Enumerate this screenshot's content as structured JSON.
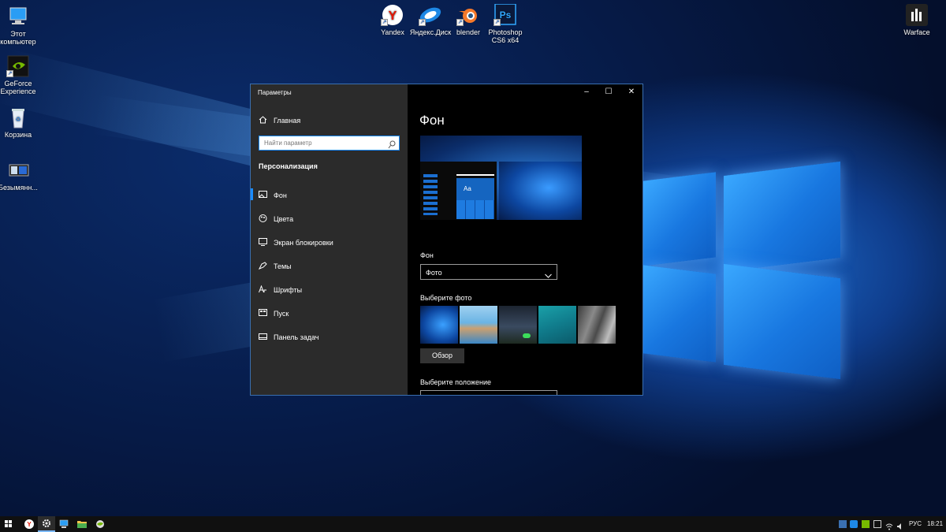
{
  "desktop_icons": [
    {
      "label": "Этот компьютер",
      "icon": "computer-icon"
    },
    {
      "label": "GeForce Experience",
      "icon": "geforce-icon"
    },
    {
      "label": "Корзина",
      "icon": "recycle-bin-icon"
    },
    {
      "label": "Безымянн...",
      "icon": "image-file-icon"
    },
    {
      "label": "Yandex",
      "icon": "yandex-icon"
    },
    {
      "label": "Яндекс.Диск",
      "icon": "yandex-disk-icon"
    },
    {
      "label": "blender",
      "icon": "blender-icon"
    },
    {
      "label": "Photoshop CS6 x64",
      "icon": "photoshop-icon",
      "badge": "Ps"
    },
    {
      "label": "Warface",
      "icon": "warface-icon"
    }
  ],
  "settings": {
    "title": "Параметры",
    "home": "Главная",
    "search_placeholder": "Найти параметр",
    "section": "Персонализация",
    "nav": [
      {
        "label": "Фон",
        "icon": "picture-icon",
        "selected": true
      },
      {
        "label": "Цвета",
        "icon": "palette-icon"
      },
      {
        "label": "Экран блокировки",
        "icon": "lock-screen-icon"
      },
      {
        "label": "Темы",
        "icon": "themes-icon"
      },
      {
        "label": "Шрифты",
        "icon": "fonts-icon"
      },
      {
        "label": "Пуск",
        "icon": "start-icon"
      },
      {
        "label": "Панель задач",
        "icon": "taskbar-icon"
      }
    ],
    "page_title": "Фон",
    "preview_sample": "Aa",
    "bg_label": "Фон",
    "bg_value": "Фото",
    "choose_photo": "Выберите фото",
    "browse": "Обзор",
    "choose_fit": "Выберите положение"
  },
  "taskbar": {
    "lang": "РУС",
    "time": "18:21"
  },
  "colors": {
    "accent": "#0078d7",
    "selected_bar": "#1a8cff"
  }
}
